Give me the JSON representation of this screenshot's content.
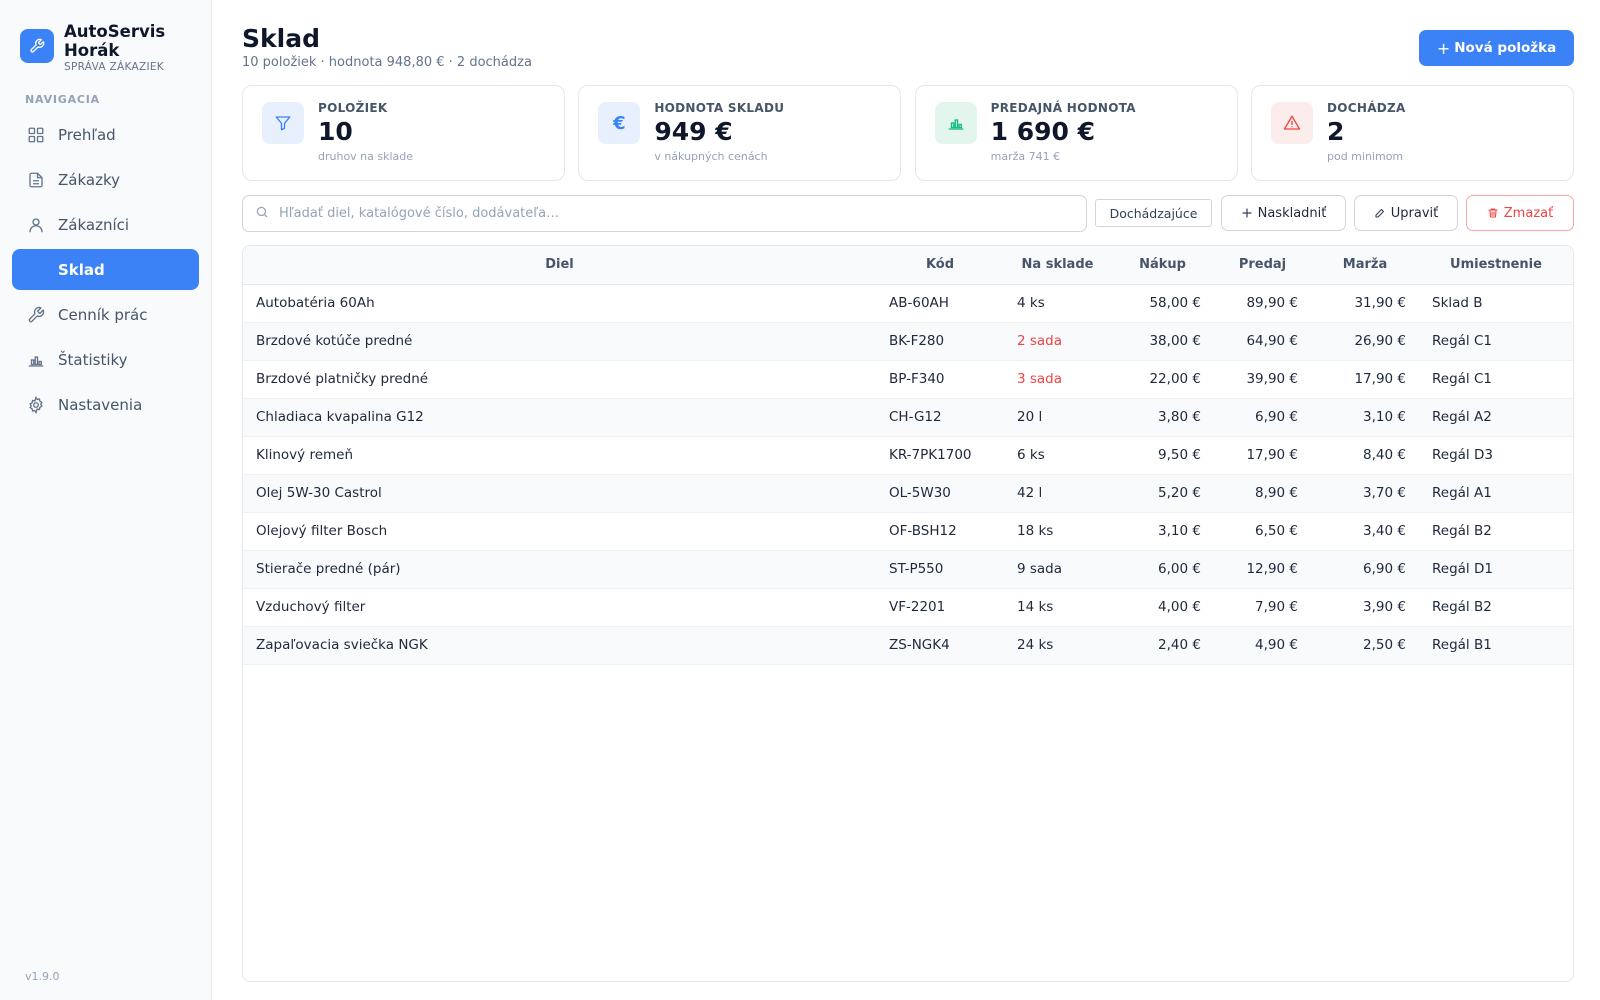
{
  "brand": {
    "name": "AutoServis Horák",
    "subtitle": "SPRÁVA ZÁKAZIEK",
    "logo_icon": "wrench-icon"
  },
  "nav": {
    "heading": "NAVIGACIA",
    "items": [
      {
        "label": "Prehľad",
        "icon": "grid-icon",
        "active": false
      },
      {
        "label": "Zákazky",
        "icon": "document-icon",
        "active": false
      },
      {
        "label": "Zákazníci",
        "icon": "user-icon",
        "active": false
      },
      {
        "label": "Sklad",
        "icon": "",
        "active": true
      },
      {
        "label": "Cenník prác",
        "icon": "wrench-icon",
        "active": false
      },
      {
        "label": "Štatistiky",
        "icon": "bar-chart-icon",
        "active": false
      },
      {
        "label": "Nastavenia",
        "icon": "gear-icon",
        "active": false
      }
    ]
  },
  "version": "v1.9.0",
  "page": {
    "title": "Sklad",
    "subtitle": "10 položiek · hodnota 948,80 € · 2 dochádza",
    "new_button": "Nová položka"
  },
  "stats": [
    {
      "label": "POLOŽIEK",
      "value": "10",
      "note": "druhov na sklade",
      "icon": "filter-icon",
      "color": "#3b82f6",
      "bg": "#e8effd"
    },
    {
      "label": "HODNOTA SKLADU",
      "value": "949 €",
      "note": "v nákupných cenách",
      "icon": "euro-icon",
      "color": "#3b82f6",
      "bg": "#e8effd"
    },
    {
      "label": "PREDAJNÁ HODNOTA",
      "value": "1 690 €",
      "note": "marža 741 €",
      "icon": "bar-chart-icon",
      "color": "#10b981",
      "bg": "#e3f6ee"
    },
    {
      "label": "DOCHÁDZA",
      "value": "2",
      "note": "pod minimom",
      "icon": "warning-icon",
      "color": "#ef4444",
      "bg": "#fdecec"
    }
  ],
  "toolbar": {
    "search_placeholder": "Hľadať diel, katalógové číslo, dodávateľa…",
    "filter_label": "Dochádzajúce",
    "stock_label": "Naskladniť",
    "edit_label": "Upraviť",
    "delete_label": "Zmazať"
  },
  "table": {
    "columns": [
      "Diel",
      "Kód",
      "Na sklade",
      "Nákup",
      "Predaj",
      "Marža",
      "Umiestnenie"
    ],
    "rows": [
      {
        "name": "Autobatéria 60Ah",
        "code": "AB-60AH",
        "stock": "4 ks",
        "low": false,
        "buy": "58,00 €",
        "sell": "89,90 €",
        "margin": "31,90 €",
        "location": "Sklad B"
      },
      {
        "name": "Brzdové kotúče predné",
        "code": "BK-F280",
        "stock": "2 sada",
        "low": true,
        "buy": "38,00 €",
        "sell": "64,90 €",
        "margin": "26,90 €",
        "location": "Regál C1"
      },
      {
        "name": "Brzdové platničky predné",
        "code": "BP-F340",
        "stock": "3 sada",
        "low": true,
        "buy": "22,00 €",
        "sell": "39,90 €",
        "margin": "17,90 €",
        "location": "Regál C1"
      },
      {
        "name": "Chladiaca kvapalina G12",
        "code": "CH-G12",
        "stock": "20 l",
        "low": false,
        "buy": "3,80 €",
        "sell": "6,90 €",
        "margin": "3,10 €",
        "location": "Regál A2"
      },
      {
        "name": "Klinový remeň",
        "code": "KR-7PK1700",
        "stock": "6 ks",
        "low": false,
        "buy": "9,50 €",
        "sell": "17,90 €",
        "margin": "8,40 €",
        "location": "Regál D3"
      },
      {
        "name": "Olej 5W-30 Castrol",
        "code": "OL-5W30",
        "stock": "42 l",
        "low": false,
        "buy": "5,20 €",
        "sell": "8,90 €",
        "margin": "3,70 €",
        "location": "Regál A1"
      },
      {
        "name": "Olejový filter Bosch",
        "code": "OF-BSH12",
        "stock": "18 ks",
        "low": false,
        "buy": "3,10 €",
        "sell": "6,50 €",
        "margin": "3,40 €",
        "location": "Regál B2"
      },
      {
        "name": "Stierače predné (pár)",
        "code": "ST-P550",
        "stock": "9 sada",
        "low": false,
        "buy": "6,00 €",
        "sell": "12,90 €",
        "margin": "6,90 €",
        "location": "Regál D1"
      },
      {
        "name": "Vzduchový filter",
        "code": "VF-2201",
        "stock": "14 ks",
        "low": false,
        "buy": "4,00 €",
        "sell": "7,90 €",
        "margin": "3,90 €",
        "location": "Regál B2"
      },
      {
        "name": "Zapaľovacia sviečka NGK",
        "code": "ZS-NGK4",
        "stock": "24 ks",
        "low": false,
        "buy": "2,40 €",
        "sell": "4,90 €",
        "margin": "2,50 €",
        "location": "Regál B1"
      }
    ]
  },
  "colors": {
    "accent": "#3b82f6",
    "danger": "#ef4444",
    "success": "#10b981"
  }
}
